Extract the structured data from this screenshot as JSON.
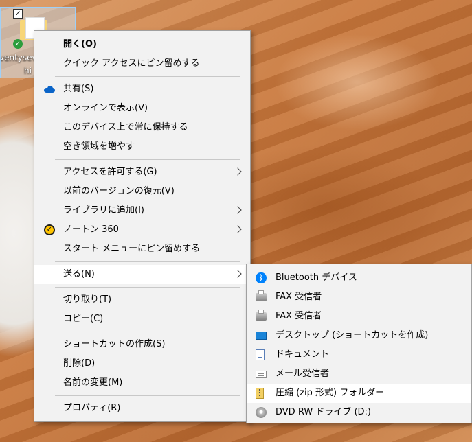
{
  "desktop": {
    "icon_label_line1": "ventysev",
    "icon_label_line2": "hi"
  },
  "context_menu": {
    "items": [
      {
        "label": "開く(O)"
      },
      {
        "label": "クイック アクセスにピン留めする"
      },
      {
        "label": "共有(S)",
        "icon": "onedrive-cloud-icon"
      },
      {
        "label": "オンラインで表示(V)"
      },
      {
        "label": "このデバイス上で常に保持する"
      },
      {
        "label": "空き領域を増やす"
      },
      {
        "label": "アクセスを許可する(G)",
        "submenu": true
      },
      {
        "label": "以前のバージョンの復元(V)"
      },
      {
        "label": "ライブラリに追加(I)",
        "submenu": true
      },
      {
        "label": "ノートン 360",
        "icon": "norton-icon",
        "submenu": true
      },
      {
        "label": "スタート メニューにピン留めする"
      },
      {
        "label": "送る(N)",
        "submenu": true,
        "highlighted": true
      },
      {
        "label": "切り取り(T)"
      },
      {
        "label": "コピー(C)"
      },
      {
        "label": "ショートカットの作成(S)"
      },
      {
        "label": "削除(D)"
      },
      {
        "label": "名前の変更(M)"
      },
      {
        "label": "プロパティ(R)"
      }
    ]
  },
  "send_to_submenu": {
    "items": [
      {
        "label": "Bluetooth デバイス",
        "icon": "bluetooth-icon"
      },
      {
        "label": "FAX 受信者",
        "icon": "fax-icon"
      },
      {
        "label": "FAX 受信者",
        "icon": "fax-icon"
      },
      {
        "label": "デスクトップ (ショートカットを作成)",
        "icon": "desktop-icon"
      },
      {
        "label": "ドキュメント",
        "icon": "document-icon"
      },
      {
        "label": "メール受信者",
        "icon": "mail-icon"
      },
      {
        "label": "圧縮 (zip 形式) フォルダー",
        "icon": "zip-folder-icon",
        "highlighted": true
      },
      {
        "label": "DVD RW ドライブ (D:)",
        "icon": "dvd-drive-icon"
      }
    ]
  },
  "colors": {
    "menu_background": "#f2f2f2",
    "highlight": "#ffffff",
    "onedrive_blue": "#0a64c8",
    "norton_yellow": "#ffc400",
    "bluetooth_blue": "#0082fc"
  }
}
